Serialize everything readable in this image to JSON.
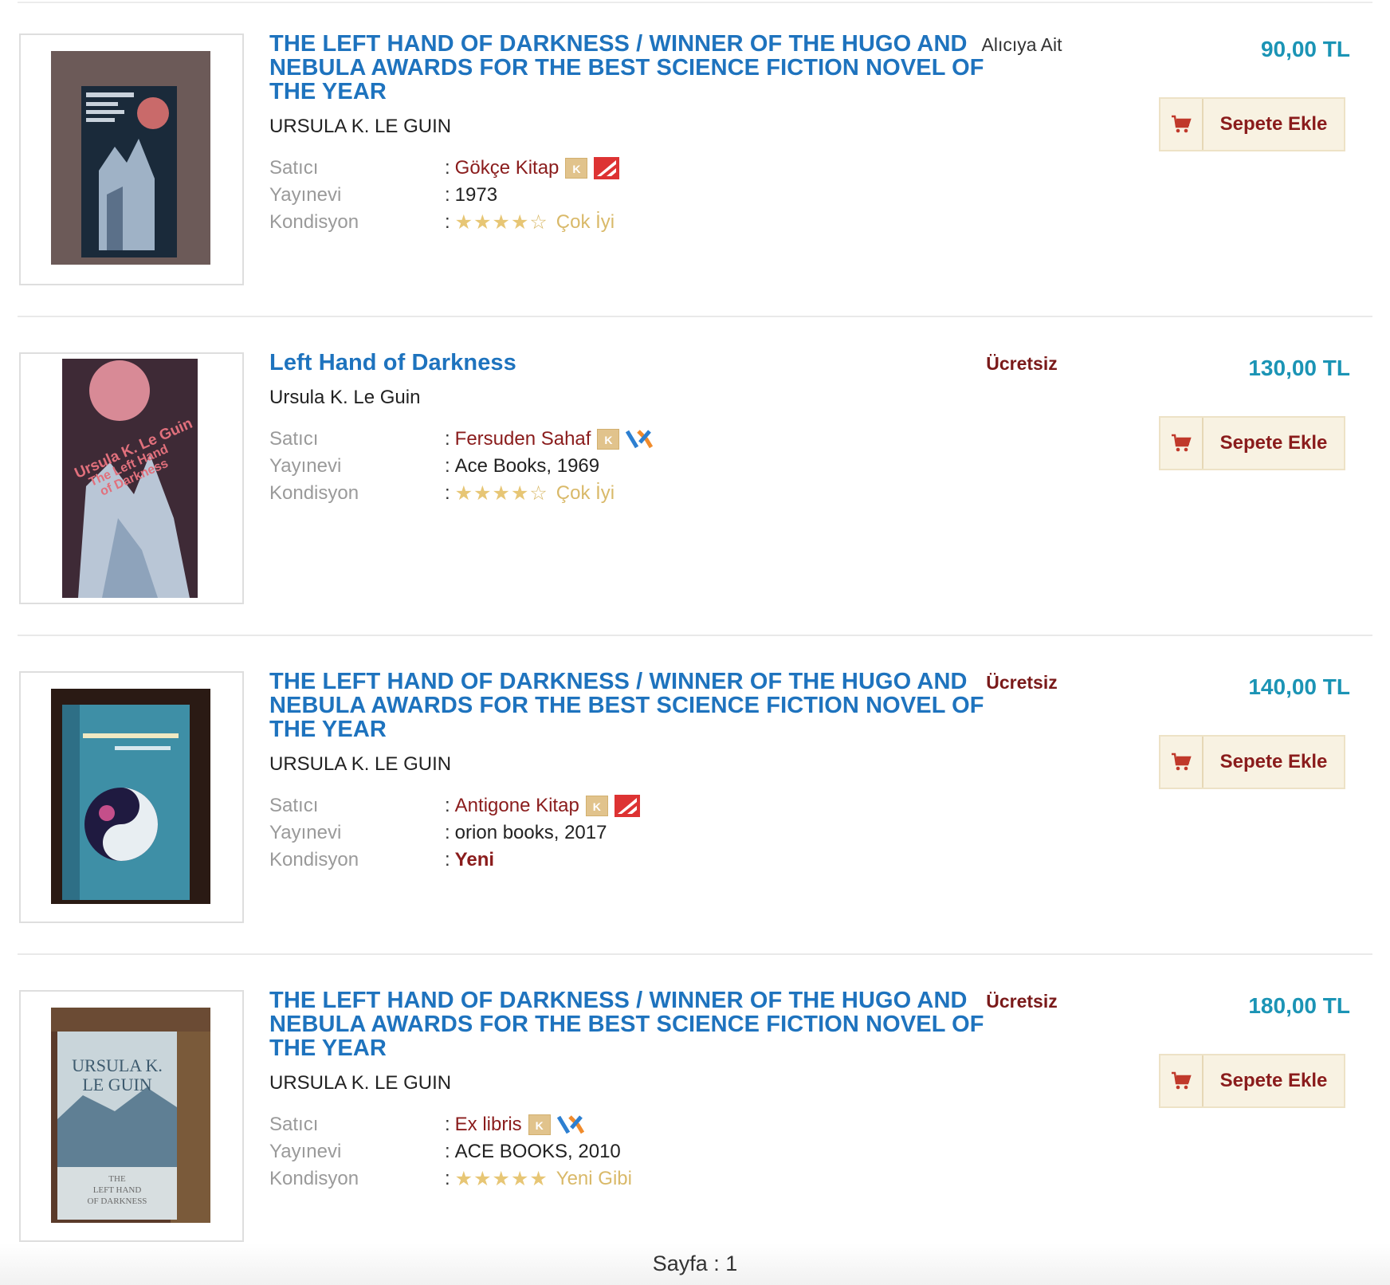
{
  "labels": {
    "seller": "Satıcı",
    "publisher": "Yayınevi",
    "condition": "Kondisyon",
    "cart_button": "Sepete Ekle"
  },
  "listings": [
    {
      "title": "THE LEFT HAND OF DARKNESS / WINNER OF THE HUGO AND NEBULA AWARDS FOR THE BEST SCIENCE FICTION NOVEL OF THE YEAR",
      "author": "URSULA K. LE GUIN",
      "seller": "Gökçe Kitap",
      "seller_badges": [
        "k-badge-icon",
        "red-square-icon"
      ],
      "publisher": "1973",
      "condition_stars": 4,
      "condition": "Çok İyi",
      "shipping": "Alıcıya Ait",
      "price": "90,00 TL"
    },
    {
      "title": "Left Hand of Darkness",
      "author": "Ursula K. Le Guin",
      "seller": "Fersuden Sahaf",
      "seller_badges": [
        "k-badge-icon",
        "x-icon"
      ],
      "publisher": "Ace Books, 1969",
      "condition_stars": 4,
      "condition": "Çok İyi",
      "shipping": "Ücretsiz",
      "price": "130,00 TL"
    },
    {
      "title": "THE LEFT HAND OF DARKNESS / WINNER OF THE HUGO AND NEBULA AWARDS FOR THE BEST SCIENCE FICTION NOVEL OF THE YEAR",
      "author": "URSULA K. LE GUIN",
      "seller": "Antigone Kitap",
      "seller_badges": [
        "k-badge-icon",
        "red-square-icon"
      ],
      "publisher": "orion books, 2017",
      "condition_stars": 0,
      "condition": "Yeni",
      "shipping": "Ücretsiz",
      "price": "140,00 TL"
    },
    {
      "title": "THE LEFT HAND OF DARKNESS / WINNER OF THE HUGO AND NEBULA AWARDS FOR THE BEST SCIENCE FICTION NOVEL OF THE YEAR",
      "author": "URSULA K. LE GUIN",
      "seller": "Ex libris",
      "seller_badges": [
        "k-badge-icon",
        "x-icon"
      ],
      "publisher": "ACE BOOKS, 2010",
      "condition_stars": 5,
      "condition": "Yeni Gibi",
      "shipping": "Ücretsiz",
      "price": "180,00 TL"
    }
  ],
  "cover_texts": {
    "cover2_lines": [
      "Ursula K. Le Guin",
      "The Left Hand",
      "of Darkness"
    ],
    "cover4_lines": [
      "URSULA K.",
      "LE GUIN",
      "THE",
      "LEFT HAND",
      "OF DARKNESS"
    ]
  },
  "pagination": {
    "label": "Sayfa : 1"
  },
  "colors": {
    "title": "#1e73be",
    "seller": "#8a1c1c",
    "price": "#1b94b5",
    "star": "#e7c675",
    "free_shipping": "#7a1a1a"
  }
}
